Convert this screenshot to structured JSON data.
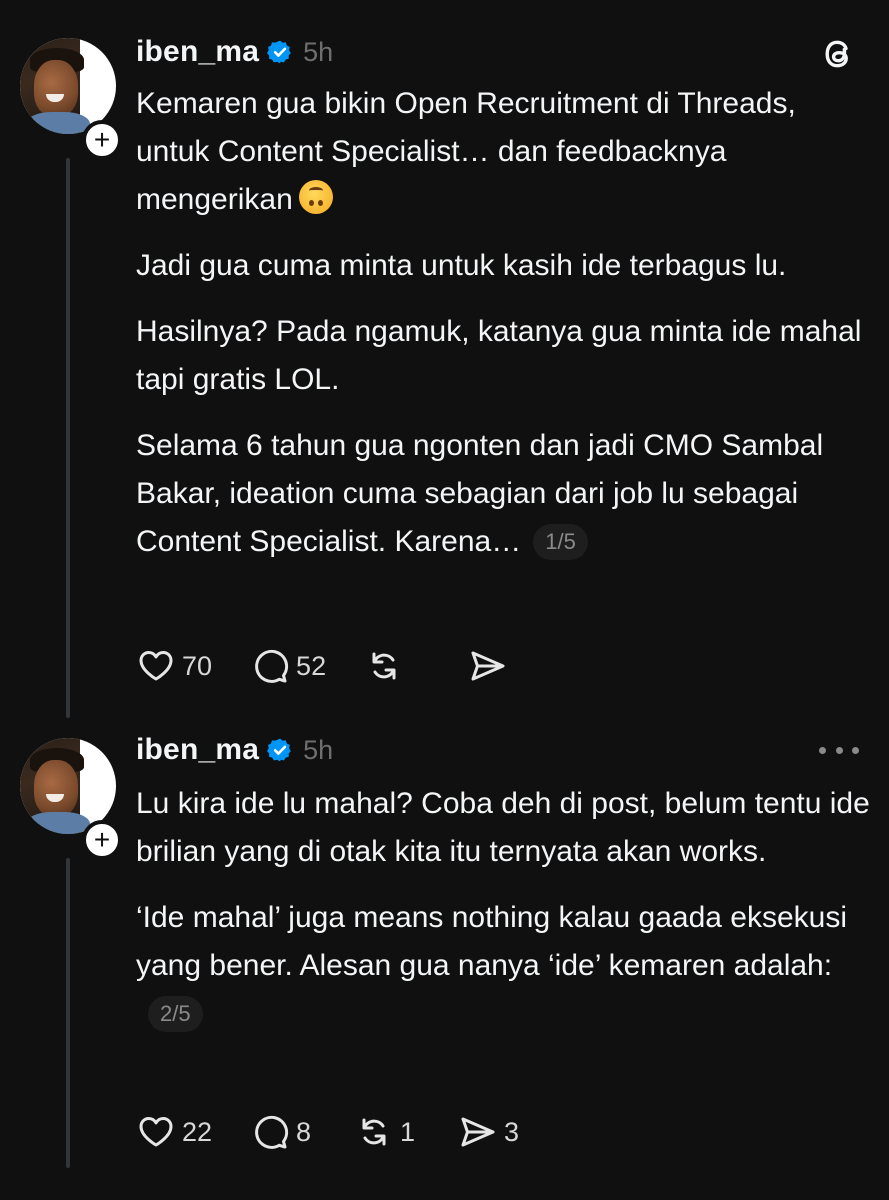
{
  "posts": [
    {
      "username": "iben_ma",
      "time": "5h",
      "paragraphs": [
        "Kemaren gua bikin Open Recruitment di Threads, untuk Content Specialist… dan feedbacknya mengerikan",
        "Jadi gua cuma minta untuk kasih ide terbagus lu.",
        "Hasilnya? Pada ngamuk, katanya gua minta ide mahal tapi gratis LOL.",
        "Selama 6 tahun gua ngonten dan jadi CMO Sambal Bakar, ideation cuma sebagian dari job lu sebagai Content Specialist. Karena…"
      ],
      "emoji": "upside-down-face-emoji",
      "page_indicator": "1/5",
      "likes": "70",
      "replies": "52",
      "reposts": "",
      "shares": "",
      "top_right_icon": "threads-logo-icon"
    },
    {
      "username": "iben_ma",
      "time": "5h",
      "paragraphs": [
        "Lu kira ide lu mahal? Coba deh di post, belum tentu ide brilian yang di otak kita itu ternyata akan works.",
        "‘Ide mahal’ juga means nothing kalau gaada eksekusi yang bener. Alesan gua nanya ‘ide’ kemaren adalah:"
      ],
      "page_indicator": "2/5",
      "likes": "22",
      "replies": "8",
      "reposts": "1",
      "shares": "3",
      "top_right_icon": "more-options-icon"
    }
  ],
  "colors": {
    "background": "#101010",
    "text": "#f3f5f7",
    "muted": "#6e6e6e",
    "verified": "#0095f6",
    "thread_line": "#333638"
  }
}
